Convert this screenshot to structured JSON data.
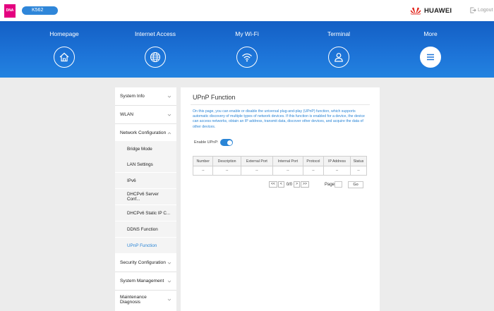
{
  "header": {
    "brand_logo_text": "DNA",
    "device_name": "K562",
    "vendor": "HUAWEI",
    "logout_label": "Logout"
  },
  "nav": {
    "items": [
      {
        "label": "Homepage",
        "icon": "home-icon"
      },
      {
        "label": "Internet Access",
        "icon": "globe-icon"
      },
      {
        "label": "My Wi-Fi",
        "icon": "wifi-icon"
      },
      {
        "label": "Terminal",
        "icon": "user-icon"
      },
      {
        "label": "More",
        "icon": "menu-icon",
        "active": true
      }
    ]
  },
  "sidebar": {
    "items": [
      {
        "label": "System Info"
      },
      {
        "label": "WLAN"
      },
      {
        "label": "Network Configuration",
        "expanded": true
      },
      {
        "label": "Bridge Mode"
      },
      {
        "label": "LAN Settings"
      },
      {
        "label": "IPv6"
      },
      {
        "label": "DHCPv6 Server Conf..."
      },
      {
        "label": "DHCPv6 Static IP C..."
      },
      {
        "label": "DDNS Function"
      },
      {
        "label": "UPnP Function",
        "active": true
      },
      {
        "label": "Security Configuration"
      },
      {
        "label": "System Management"
      },
      {
        "label": "Maintenance Diagnosis"
      }
    ]
  },
  "content": {
    "title": "UPnP Function",
    "description": "On this page, you can enable or disable the universal plug-and-play (UPnP) function, which supports automatic discovery of multiple types of network devices. If this function is enabled for a device, the device can access networks, obtain an IP address, transmit data, discover other devices, and acquire the data of other devices.",
    "enable_label": "Enable UPnP:",
    "enabled": true,
    "table": {
      "columns": [
        "Number",
        "Description",
        "External Port",
        "Internal Port",
        "Protocol",
        "IP Address",
        "Status"
      ],
      "rows": [
        [
          "--",
          "--",
          "--",
          "--",
          "--",
          "--",
          "--"
        ]
      ]
    },
    "pager": {
      "first": "<<",
      "prev": "<",
      "info": "0/0",
      "next": ">",
      "last": ">>",
      "page_label": "Page",
      "page_value": "",
      "go_label": "Go"
    }
  },
  "colors": {
    "accent": "#2a85d6",
    "nav_bg": "#1d74d8",
    "brand": "#e4007f"
  }
}
